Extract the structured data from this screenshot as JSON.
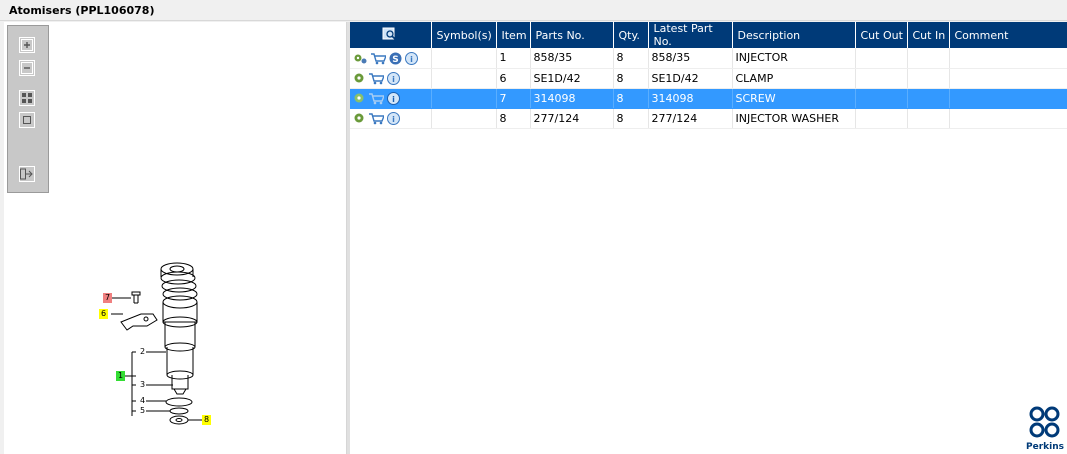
{
  "window": {
    "title": "Atomisers (PPL106078)"
  },
  "toolbar": {
    "buttons": [
      "zoom-in-icon",
      "zoom-out-icon",
      "fit-all-icon",
      "actual-size-icon",
      "export-icon"
    ]
  },
  "table": {
    "columns": [
      "",
      "Symbol(s)",
      "Item",
      "Parts No.",
      "Qty.",
      "Latest Part No.",
      "Description",
      "Cut Out",
      "Cut In",
      "Comment"
    ],
    "rows": [
      {
        "icons": [
          "gears-icon",
          "cart-icon",
          "s-badge-icon",
          "info-icon"
        ],
        "symbols": "",
        "item": "1",
        "part_no": "858/35",
        "qty": "8",
        "latest": "858/35",
        "description": "INJECTOR",
        "cut_out": "",
        "cut_in": "",
        "comment": "",
        "selected": false
      },
      {
        "icons": [
          "gear-icon",
          "cart-icon",
          "info-icon"
        ],
        "symbols": "",
        "item": "6",
        "part_no": "SE1D/42",
        "qty": "8",
        "latest": "SE1D/42",
        "description": "CLAMP",
        "cut_out": "",
        "cut_in": "",
        "comment": "",
        "selected": false
      },
      {
        "icons": [
          "gear-icon",
          "cart-icon",
          "info-icon"
        ],
        "symbols": "",
        "item": "7",
        "part_no": "314098",
        "qty": "8",
        "latest": "314098",
        "description": "SCREW",
        "cut_out": "",
        "cut_in": "",
        "comment": "",
        "selected": true
      },
      {
        "icons": [
          "gear-icon",
          "cart-icon",
          "info-icon"
        ],
        "symbols": "",
        "item": "8",
        "part_no": "277/124",
        "qty": "8",
        "latest": "277/124",
        "description": "INJECTOR WASHER",
        "cut_out": "",
        "cut_in": "",
        "comment": "",
        "selected": false
      }
    ]
  },
  "diagram": {
    "callouts": [
      {
        "label": "7",
        "color": "#f08080"
      },
      {
        "label": "6",
        "color": "#ffff00"
      },
      {
        "label": "1",
        "color": "#33dd33"
      },
      {
        "label": "8",
        "color": "#ffff00"
      }
    ],
    "sub_labels": [
      "2",
      "3",
      "4",
      "5"
    ]
  },
  "brand": {
    "name": "Perkins",
    "color": "#003a78"
  },
  "colors": {
    "header_bg": "#003a78",
    "selected_row": "#3399ff"
  }
}
